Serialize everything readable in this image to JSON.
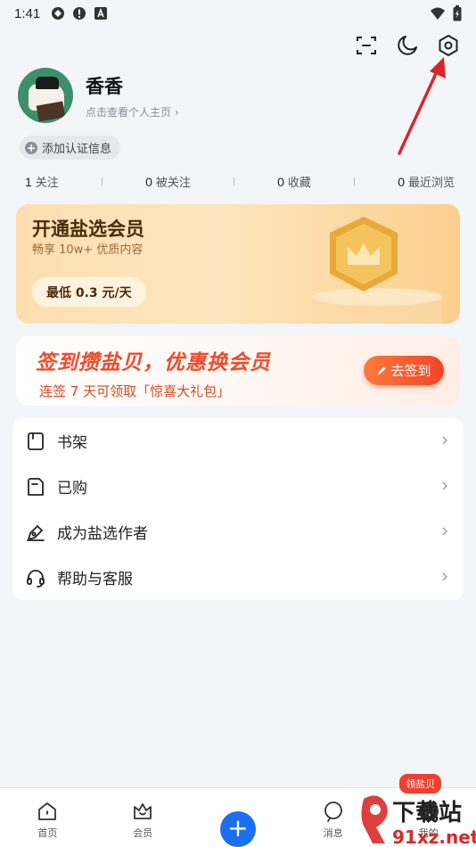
{
  "status_bar": {
    "time": "1:41"
  },
  "header": {
    "icons": [
      "scan-icon",
      "dark-mode-icon",
      "settings-icon"
    ]
  },
  "profile": {
    "name": "香香",
    "link_text": "点击查看个人主页 ›"
  },
  "cert_chip": {
    "label": "添加认证信息"
  },
  "stats": [
    {
      "count": "1",
      "label": "关注"
    },
    {
      "count": "0",
      "label": "被关注"
    },
    {
      "count": "0",
      "label": "收藏"
    },
    {
      "count": "0",
      "label": "最近浏览"
    }
  ],
  "vip_card": {
    "title": "开通盐选会员",
    "subtitle": "畅享 10w+ 优质内容",
    "button": "最低 0.3 元/天"
  },
  "sign_card": {
    "title": "签到攒盐贝，优惠换会员",
    "subtitle": "连签 7 天可领取「惊喜大礼包」",
    "button": "去签到"
  },
  "menu": [
    {
      "label": "书架",
      "icon": "bookshelf-icon"
    },
    {
      "label": "已购",
      "icon": "purchased-icon"
    },
    {
      "label": "成为盐选作者",
      "icon": "author-pen-icon"
    },
    {
      "label": "帮助与客服",
      "icon": "headset-icon"
    }
  ],
  "bottom_nav": {
    "items": [
      {
        "label": "首页",
        "icon": "home-icon"
      },
      {
        "label": "会员",
        "icon": "vip-icon"
      },
      {
        "label": "",
        "icon": "plus-icon"
      },
      {
        "label": "消息",
        "icon": "message-icon"
      },
      {
        "label": "我的",
        "icon": "profile-icon"
      }
    ],
    "badge": "领盐贝"
  },
  "watermark": {
    "text": "下载站",
    "domain": "91xz.net"
  },
  "colors": {
    "accent_blue": "#1c6ef3",
    "sign_red": "#ef4c2c",
    "vip_brown": "#4a2c0d",
    "annotation_arrow": "#d8262a"
  }
}
